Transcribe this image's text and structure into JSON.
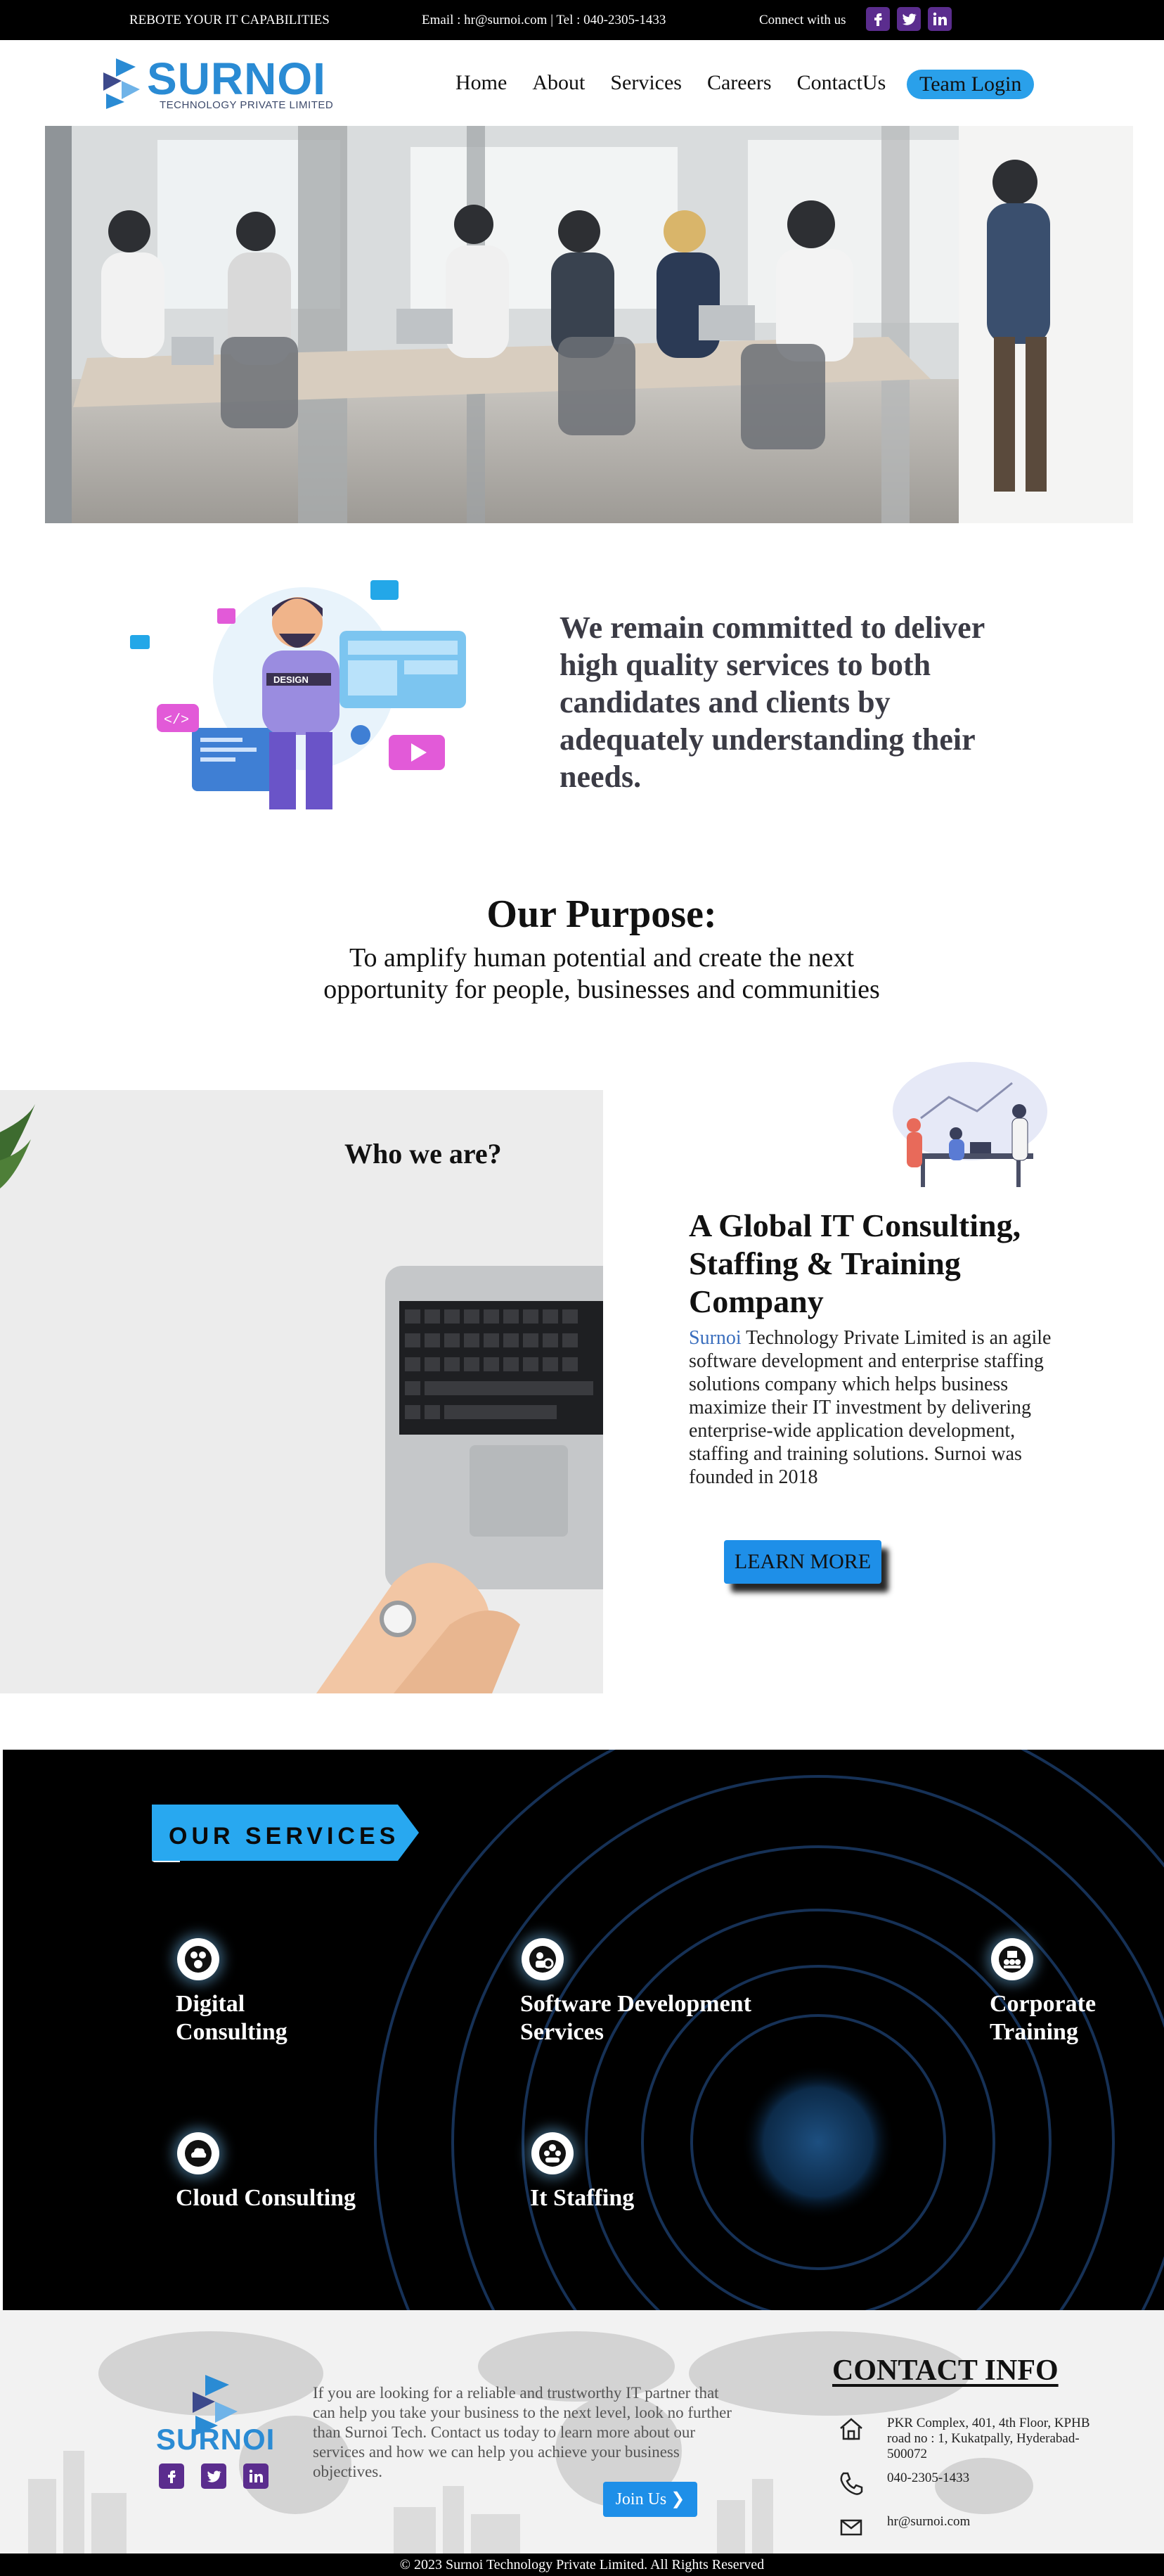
{
  "topbar": {
    "tagline": "REBOTE YOUR IT CAPABILITIES",
    "contact": "Email : hr@surnoi.com | Tel : 040-2305-1433",
    "connect_label": "Connect with us",
    "social_icons": [
      "facebook-icon",
      "twitter-icon",
      "linkedin-icon"
    ]
  },
  "header": {
    "logo_word": "SURNOI",
    "logo_sub": "TECHNOLOGY PRIVATE LIMITED",
    "nav": [
      "Home",
      "About",
      "Services",
      "Careers",
      "ContactUs"
    ],
    "login_label": "Team Login"
  },
  "commitment": {
    "text": "We remain committed to deliver high quality services to both candidates and clients by adequately understanding their needs."
  },
  "purpose": {
    "title": "Our Purpose:",
    "text": "To amplify human potential and create the next opportunity for people, businesses and communities"
  },
  "about": {
    "who_title": "Who we are?",
    "heading": "A Global IT Consulting, Staffing & Training Company",
    "brand": "Surnoi",
    "body": " Technology Private Limited is an agile software development and enterprise staffing solutions company which helps business maximize their IT investment by delivering enterprise-wide application development, staffing and training solutions. Surnoi was founded in 2018",
    "cta": "LEARN MORE"
  },
  "services": {
    "banner": "OUR SERVICES",
    "items": [
      {
        "label_1": "Digital",
        "label_2": "Consulting"
      },
      {
        "label_1": "Software Development",
        "label_2": "Services"
      },
      {
        "label_1": "Corporate",
        "label_2": "Training"
      },
      {
        "label_1": "Cloud Consulting",
        "label_2": ""
      },
      {
        "label_1": "It Staffing",
        "label_2": ""
      }
    ]
  },
  "footer": {
    "logo_word": "SURNOI",
    "blurb": "If you are looking for a reliable and trustworthy IT partner that can help you take your business to the next level, look no further than Surnoi Tech. Contact us today to learn more about our services and how we can help you achieve your business objectives.",
    "join_label": "Join Us",
    "contact_title": "CONTACT INFO",
    "address": "PKR Complex, 401, 4th Floor, KPHB road no : 1, Kukatpally, Hyderabad-500072",
    "phone": "040-2305-1433",
    "email": "hr@surnoi.com",
    "copyright": "© 2023 Surnoi Technology Private Limited. All Rights Reserved"
  },
  "colors": {
    "brand_blue": "#2a8bd4",
    "button_blue": "#1e8fe8",
    "social_purple": "#5b2d8e",
    "topbar_bg": "#000000"
  }
}
